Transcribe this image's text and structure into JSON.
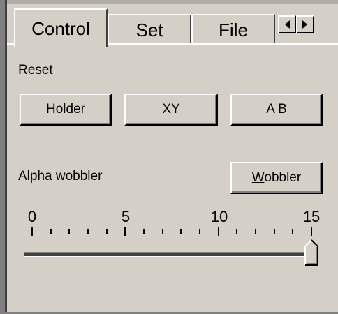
{
  "tabs": [
    {
      "label": "Control",
      "active": true
    },
    {
      "label": "Set",
      "active": false
    },
    {
      "label": "File",
      "active": false
    }
  ],
  "tab_scroll": {
    "left_icon": "arrow-left-icon",
    "right_icon": "arrow-right-icon"
  },
  "reset": {
    "label": "Reset",
    "buttons": [
      {
        "mnemonic": "H",
        "rest": "older"
      },
      {
        "mnemonic": "X",
        "rest": "Y"
      },
      {
        "mnemonic": "A",
        "rest": " B"
      }
    ]
  },
  "wobbler": {
    "label": "Alpha wobbler",
    "button": {
      "mnemonic": "W",
      "rest": "obbler"
    }
  },
  "slider": {
    "tick_labels": [
      "0",
      "5",
      "10",
      "15"
    ],
    "min": 0,
    "max": 15,
    "value": 15
  }
}
